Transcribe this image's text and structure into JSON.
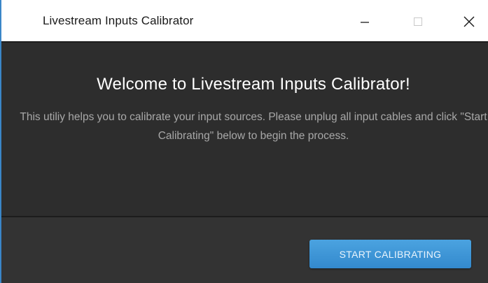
{
  "window": {
    "title": "Livestream Inputs Calibrator",
    "controls": {
      "minimize": "minimize-icon",
      "maximize": "maximize-icon",
      "close": "close-icon"
    }
  },
  "main": {
    "heading": "Welcome to Livestream Inputs Calibrator!",
    "description": "This utiliy helps you to calibrate your input sources. Please unplug all input cables and click \"Start Calibrating\" below to begin the process."
  },
  "footer": {
    "start_label": "START CALIBRATING"
  },
  "colors": {
    "accent": "#3a96d8",
    "background": "#2d2d2d",
    "footer": "#333333",
    "heading_text": "#ffffff",
    "body_text": "#a8a8a8"
  }
}
